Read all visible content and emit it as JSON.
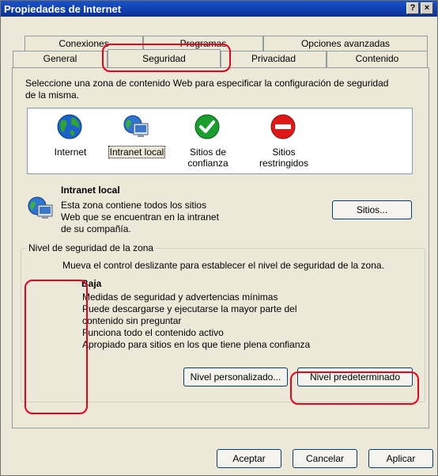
{
  "window": {
    "title": "Propiedades de Internet",
    "help_button": "?",
    "close_button": "×"
  },
  "tabs": {
    "row1": [
      {
        "label": "Conexiones"
      },
      {
        "label": "Programas"
      },
      {
        "label": "Opciones avanzadas"
      }
    ],
    "row2": [
      {
        "label": "General"
      },
      {
        "label": "Seguridad"
      },
      {
        "label": "Privacidad"
      },
      {
        "label": "Contenido"
      }
    ],
    "active": "Seguridad"
  },
  "panel": {
    "intro_line1": "Seleccione una zona de contenido Web para especificar la configuración de seguridad",
    "intro_line2": "de la misma.",
    "zones": [
      {
        "label": "Internet",
        "icon": "globe-icon"
      },
      {
        "label": "Intranet local",
        "icon": "local-intranet-icon"
      },
      {
        "label": "Sitios de confianza",
        "icon": "green-check-icon"
      },
      {
        "label": "Sitios restringidos",
        "icon": "red-no-entry-icon"
      }
    ],
    "selected_zone": {
      "title": "Intranet local",
      "desc_line1": "Esta zona contiene todos los sitios",
      "desc_line2": "Web que se encuentran en la intranet",
      "desc_line3": "de su compañía.",
      "sites_button": "Sitios..."
    },
    "security_level": {
      "group_label": "Nivel de seguridad de la zona",
      "hint": "Mueva el control deslizante para establecer el nivel de seguridad de la zona.",
      "level_name": "Baja",
      "details": [
        "Medidas de seguridad y advertencias mínimas",
        "Puede descargarse y ejecutarse la mayor parte del",
        "contenido sin preguntar",
        "Funciona todo el contenido activo",
        "Apropiado para sitios en los que tiene plena confianza"
      ],
      "slider_level": "Baja",
      "custom_button": "Nivel personalizado...",
      "default_button": "Nivel predeterminado"
    }
  },
  "footer": {
    "ok": "Aceptar",
    "cancel": "Cancelar",
    "apply": "Aplicar"
  },
  "colors": {
    "titlebar": "#0a2f97",
    "dialog_bg": "#ece9d8",
    "annotation_red": "#e8001c"
  }
}
